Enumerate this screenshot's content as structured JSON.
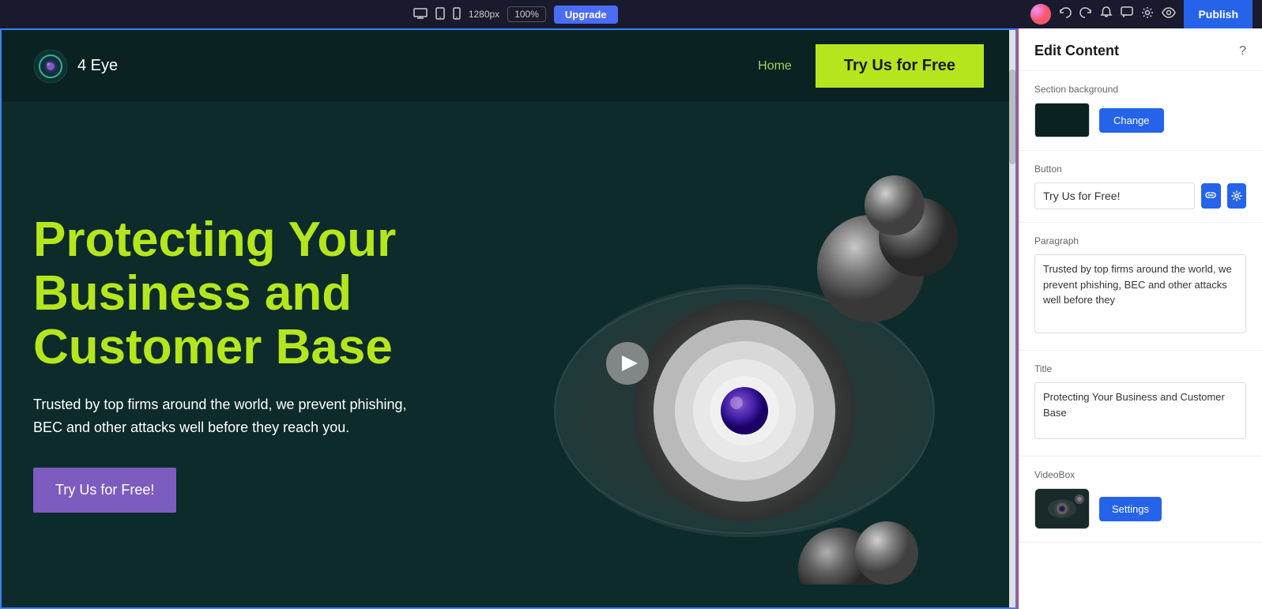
{
  "toolbar": {
    "resolution": "1280px",
    "zoom": "100%",
    "upgrade_label": "Upgrade",
    "publish_label": "Publish",
    "icons": {
      "desktop": "🖥",
      "tablet": "📱",
      "mobile": "📱",
      "undo": "↩",
      "redo": "↪",
      "bell": "🔔",
      "comment": "💬",
      "sliders": "⚙",
      "eye": "👁"
    }
  },
  "nav": {
    "logo_text": "4 Eye",
    "home_link": "Home",
    "cta_button": "Try Us for Free"
  },
  "hero": {
    "title": "Protecting Your Business and Customer Base",
    "subtitle": "Trusted by top firms around the world, we prevent phishing, BEC and other attacks well before they reach you.",
    "cta_button": "Try Us for Free!"
  },
  "edit_panel": {
    "title": "Edit Content",
    "help_label": "?",
    "section_bg_label": "Section background",
    "change_btn_label": "Change",
    "button_label": "Button",
    "button_value": "Try Us for Free!",
    "paragraph_label": "Paragraph",
    "paragraph_value": "Trusted by top firms around the world, we prevent phishing, BEC and other attacks well before they",
    "title_label": "Title",
    "title_value": "Protecting Your Business and Customer Base",
    "videobox_label": "VideoBox",
    "settings_btn_label": "Settings"
  }
}
